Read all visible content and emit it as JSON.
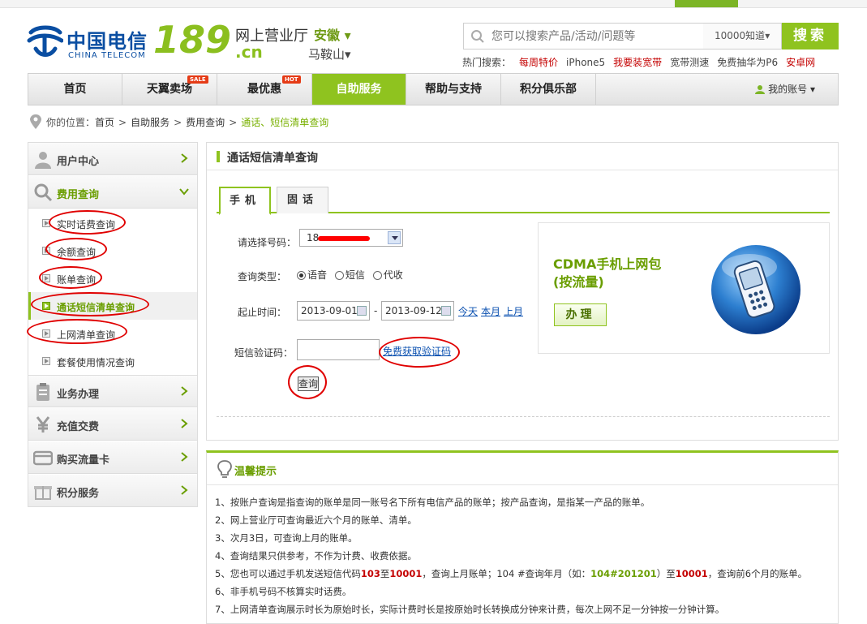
{
  "header": {
    "logo_cn": "中国电信",
    "logo_en": "CHINA TELECOM",
    "logo_189": "189",
    "logo_subtitle": "网上营业厅",
    "logo_domain": ".cn",
    "province": "安徽",
    "city": "马鞍山"
  },
  "search": {
    "placeholder": "您可以搜索产品/活动/问题等",
    "scope": "10000知道",
    "button": "搜索"
  },
  "hot_search": {
    "label": "热门搜索：",
    "items": [
      "每周特价",
      "iPhone5",
      "我要装宽带",
      "宽带测速",
      "免费抽华为P6",
      "安卓网"
    ]
  },
  "nav": {
    "items": [
      "首页",
      "天翼卖场",
      "最优惠",
      "自助服务",
      "帮助与支持",
      "积分俱乐部"
    ],
    "tag_sale": "SALE",
    "tag_hot": "HOT",
    "account": "我的账号"
  },
  "breadcrumb": {
    "prefix": "你的位置：",
    "items": [
      "首页",
      "自助服务",
      "费用查询"
    ],
    "current": "通话、短信清单查询",
    "sep": ">"
  },
  "sidebar": {
    "sections": [
      "用户中心",
      "费用查询",
      "业务办理",
      "充值交费",
      "购买流量卡",
      "积分服务"
    ],
    "sub_items": [
      "实时话费查询",
      "余额查询",
      "账单查询",
      "通话短信清单查询",
      "上网清单查询",
      "套餐使用情况查询"
    ]
  },
  "panel": {
    "title": "通话短信清单查询",
    "tabs": [
      "手机",
      "固话"
    ],
    "labels": {
      "number": "请选择号码：",
      "type": "查询类型：",
      "time": "起止时间：",
      "sms": "短信验证码："
    },
    "number_prefix": "18",
    "types": [
      "语音",
      "短信",
      "代收"
    ],
    "start_date": "2013-09-01",
    "end_date": "2013-09-12",
    "date_sep": "-",
    "quick": [
      "今天",
      "本月",
      "上月"
    ],
    "get_code": "免费获取验证码",
    "query": "查询"
  },
  "promo": {
    "title_line1": "CDMA手机上网包",
    "title_line2": "(按流量)",
    "button": "办理"
  },
  "tips": {
    "title": "温馨提示",
    "t1": "1、按账户查询是指查询的账单是同一账号名下所有电信产品的账单；按产品查询，是指某一产品的账单。",
    "t2": "2、网上营业厅可查询最近六个月的账单、清单。",
    "t3": "3、次月3日，可查询上月的账单。",
    "t4": "4、查询结果只供参考，不作为计费、收费依据。",
    "t5_a": "5、您也可以通过手机发送短信代码",
    "t5_code1": "103",
    "t5_b": "至",
    "t5_num": "10001",
    "t5_c": "，查询上月账单；104 #查询年月（如：",
    "t5_example": "104#201201",
    "t5_d": "）至",
    "t5_num2": "10001",
    "t5_e": "，查询前6个月的账单。",
    "t6": "6、非手机号码不核算实时话费。",
    "t7": "7、上网清单查询展示时长为原始时长，实际计费时长是按原始时长转换成分钟来计费，每次上网不足一分钟按一分钟计算。"
  },
  "colors": {
    "brand_green": "#8fc31f",
    "brand_blue": "#0a4ea2",
    "highlight_red": "#c40000",
    "annotation_red": "#e00000"
  }
}
